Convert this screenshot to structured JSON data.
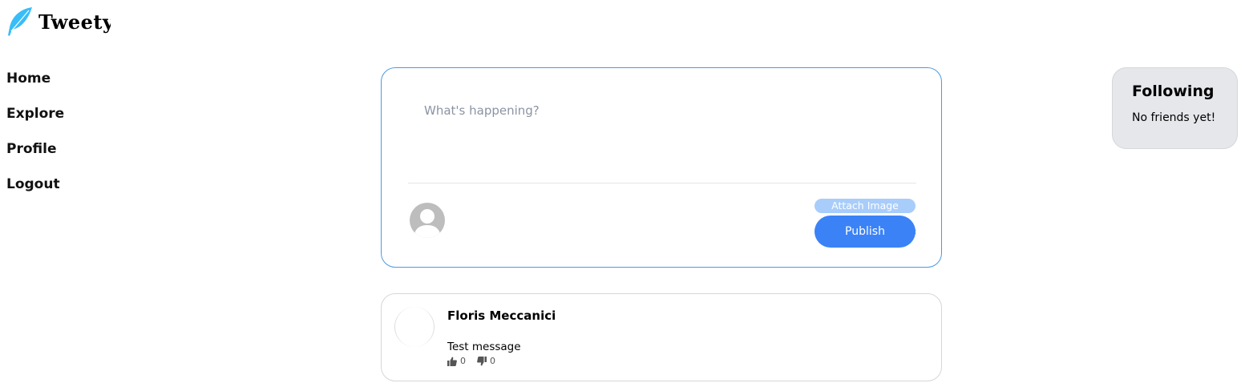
{
  "app": {
    "name": "Tweety",
    "brand_color": "#38bdf8"
  },
  "nav": {
    "items": [
      {
        "label": "Home"
      },
      {
        "label": "Explore"
      },
      {
        "label": "Profile"
      },
      {
        "label": "Logout"
      }
    ]
  },
  "compose": {
    "placeholder": "What's happening?",
    "attach_label": "Attach Image",
    "publish_label": "Publish",
    "accent_color": "#3b82f6"
  },
  "following": {
    "title": "Following",
    "empty_text": "No friends yet!"
  },
  "tweets": [
    {
      "author": "Floris Meccanici",
      "text": "Test message",
      "likes": "0",
      "dislikes": "0"
    }
  ]
}
